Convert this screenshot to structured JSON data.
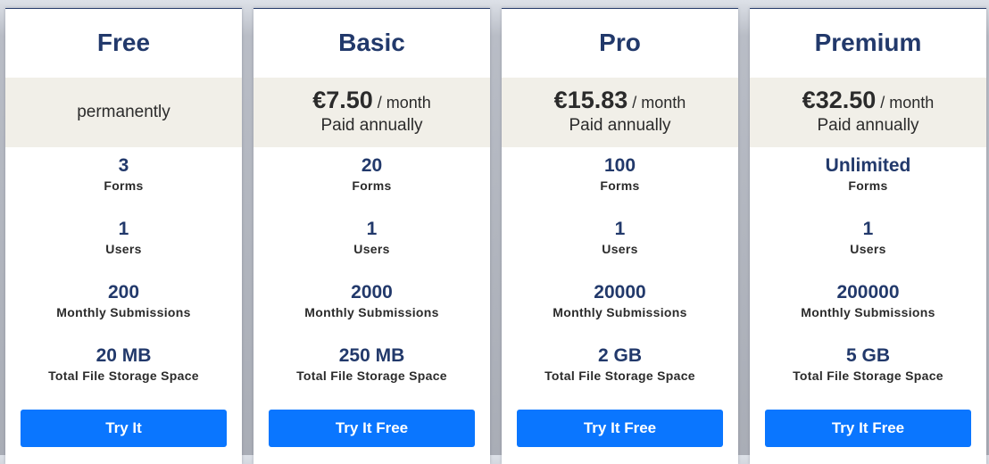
{
  "plans": [
    {
      "name": "Free",
      "pricing": {
        "type": "note",
        "note": "permanently"
      },
      "features": [
        {
          "value": "3",
          "label": "Forms"
        },
        {
          "value": "1",
          "label": "Users"
        },
        {
          "value": "200",
          "label": "Monthly Submissions"
        },
        {
          "value": "20 MB",
          "label": "Total File Storage Space"
        }
      ],
      "cta_label": "Try It"
    },
    {
      "name": "Basic",
      "pricing": {
        "type": "price",
        "amount": "€7.50",
        "period": "/ month",
        "billing": "Paid annually"
      },
      "features": [
        {
          "value": "20",
          "label": "Forms"
        },
        {
          "value": "1",
          "label": "Users"
        },
        {
          "value": "2000",
          "label": "Monthly Submissions"
        },
        {
          "value": "250 MB",
          "label": "Total File Storage Space"
        }
      ],
      "cta_label": "Try It Free"
    },
    {
      "name": "Pro",
      "pricing": {
        "type": "price",
        "amount": "€15.83",
        "period": "/ month",
        "billing": "Paid annually"
      },
      "features": [
        {
          "value": "100",
          "label": "Forms"
        },
        {
          "value": "1",
          "label": "Users"
        },
        {
          "value": "20000",
          "label": "Monthly Submissions"
        },
        {
          "value": "2 GB",
          "label": "Total File Storage Space"
        }
      ],
      "cta_label": "Try It Free"
    },
    {
      "name": "Premium",
      "pricing": {
        "type": "price",
        "amount": "€32.50",
        "period": "/ month",
        "billing": "Paid annually"
      },
      "features": [
        {
          "value": "Unlimited",
          "label": "Forms"
        },
        {
          "value": "1",
          "label": "Users"
        },
        {
          "value": "200000",
          "label": "Monthly Submissions"
        },
        {
          "value": "5 GB",
          "label": "Total File Storage Space"
        }
      ],
      "cta_label": "Try It Free"
    }
  ],
  "colors": {
    "plan_name": "#22396b",
    "price_band": "#f1efe8",
    "cta": "#0a76ff"
  }
}
